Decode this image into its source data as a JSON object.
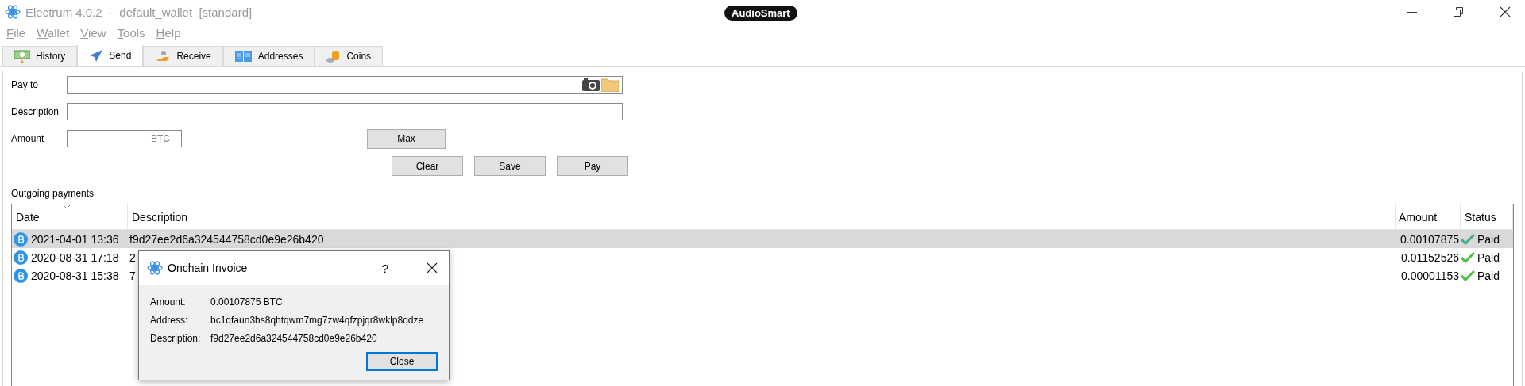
{
  "window": {
    "title": "Electrum 4.0.2  -  default_wallet  [standard]",
    "overlay_badge": "AudioSmart"
  },
  "menu": [
    "File",
    "Wallet",
    "View",
    "Tools",
    "Help"
  ],
  "tabs": [
    {
      "label": "History",
      "kind": "history",
      "selected": false
    },
    {
      "label": "Send",
      "kind": "send",
      "selected": true
    },
    {
      "label": "Receive",
      "kind": "receive",
      "selected": false
    },
    {
      "label": "Addresses",
      "kind": "addresses",
      "selected": false
    },
    {
      "label": "Coins",
      "kind": "coins",
      "selected": false
    }
  ],
  "form": {
    "pay_to_label": "Pay to",
    "description_label": "Description",
    "amount_label": "Amount",
    "amount_unit": "BTC",
    "max_button": "Max",
    "buttons": [
      "Clear",
      "Save",
      "Pay"
    ]
  },
  "outgoing": {
    "title": "Outgoing payments",
    "columns": [
      "Date",
      "Description",
      "Amount",
      "Status"
    ],
    "rows": [
      {
        "date": "2021-04-01 13:36",
        "description": "f9d27ee2d6a324544758cd0e9e26b420",
        "amount": "0.00107875",
        "status": "Paid",
        "selected": true
      },
      {
        "date": "2020-08-31 17:18",
        "description": "2",
        "amount": "0.01152526",
        "status": "Paid",
        "selected": false
      },
      {
        "date": "2020-08-31 15:38",
        "description": "7",
        "amount": "0.00001153",
        "status": "Paid",
        "selected": false
      }
    ]
  },
  "dialog": {
    "title": "Onchain Invoice",
    "help": "?",
    "fields": [
      {
        "label": "Amount:",
        "value": "0.00107875 BTC"
      },
      {
        "label": "Address:",
        "value": "bc1qfaun3hs8qhtqwm7mg7zw4qfzpjqr8wklp8qdze"
      },
      {
        "label": "Description:",
        "value": "f9d27ee2d6a324544758cd0e9e26b420"
      }
    ],
    "button": "Close"
  }
}
